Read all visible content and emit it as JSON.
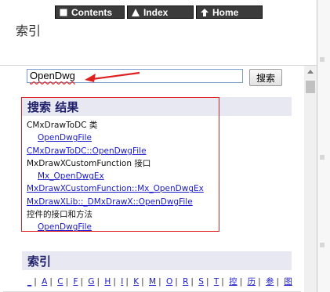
{
  "nav": {
    "buttons": [
      {
        "label": "Contents",
        "icon": "square-icon"
      },
      {
        "label": "Index",
        "icon": "triangle-icon"
      },
      {
        "label": "Home",
        "icon": "home-arrow-icon"
      }
    ]
  },
  "page_title": "索引",
  "search": {
    "value": "OpenDwg",
    "button_label": "搜索"
  },
  "results": {
    "header": "搜索 结果",
    "items": [
      {
        "text": "CMxDrawToDC 类",
        "kind": "plain"
      },
      {
        "text": "OpenDwgFile",
        "kind": "link",
        "indent": true
      },
      {
        "text": "CMxDrawToDC::OpenDwgFile",
        "kind": "link"
      },
      {
        "text": "MxDrawXCustomFunction 接口",
        "kind": "plain"
      },
      {
        "text": "Mx_OpenDwgEx",
        "kind": "link",
        "indent": true
      },
      {
        "text": "MxDrawXCustomFunction::Mx_OpenDwgEx",
        "kind": "link"
      },
      {
        "text": "MxDrawXLib::_DMxDrawX::OpenDwgFile",
        "kind": "link"
      },
      {
        "text": "控件的接口和方法",
        "kind": "plain"
      },
      {
        "text": "OpenDwgFile",
        "kind": "link",
        "indent": true
      }
    ]
  },
  "index_section": {
    "header": "索引",
    "letters": [
      "_",
      "A",
      "C",
      "F",
      "G",
      "H",
      "I",
      "K",
      "M",
      "O",
      "R",
      "S",
      "T",
      "控",
      "历",
      "参",
      "图"
    ]
  },
  "colors": {
    "accent_red": "#e02020",
    "link_blue": "#1a1acc",
    "section_bg": "#e8e8f2"
  }
}
